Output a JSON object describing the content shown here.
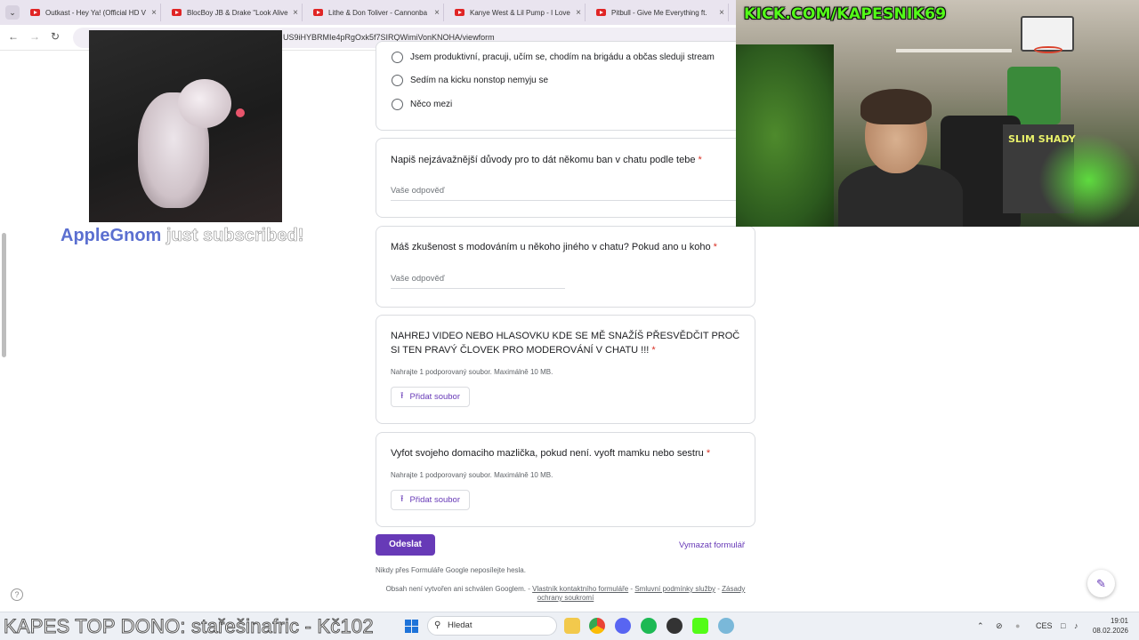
{
  "browser": {
    "tabs": [
      {
        "title": "Outkast - Hey Ya! (Official HD V"
      },
      {
        "title": "BlocBoy JB & Drake \"Look Alive"
      },
      {
        "title": "Lithe & Don Toliver - Cannonba"
      },
      {
        "title": "Kanye West & Lil Pump - I Love"
      },
      {
        "title": "Pitbull - Give Me Everything ft."
      }
    ],
    "url": "US9iHYBRMIe4pRgOxk5f7SIRQWimiVonKNOHA/viewform"
  },
  "form": {
    "radio_options": [
      "Jsem produktivní, pracuji, učím se, chodím na brigádu a občas sleduji stream",
      "Sedím na kicku nonstop nemyju se",
      "Něco mezi"
    ],
    "q_ban": {
      "text": "Napiš nejzávažnější důvody pro to dát někomu ban v chatu podle tebe",
      "required": "*",
      "placeholder": "Vaše odpověď"
    },
    "q_mod": {
      "text": "Máš zkušenost s modováním u někoho jiného v chatu? Pokud ano u koho",
      "required": "*",
      "placeholder": "Vaše odpověď"
    },
    "q_video": {
      "text": "NAHREJ VIDEO NEBO HLASOVKU KDE SE MĚ SNAŽÍŠ PŘESVĚDČIT PROČ SI TEN PRAVÝ ČLOVEK PRO MODEROVÁNÍ V CHATU !!!",
      "required": "*",
      "hint": "Nahrajte 1 podporovaný soubor. Maximálně 10 MB.",
      "button": "Přidat soubor"
    },
    "q_pet": {
      "text": "Vyfot svojeho domaciho mazlička, pokud není. vyoft mamku nebo sestru",
      "required": "*",
      "hint": "Nahrajte 1 podporovaný soubor. Maximálně 10 MB.",
      "button": "Přidat soubor"
    },
    "submit": "Odeslat",
    "clear": "Vymazat formulář",
    "never_passwords": "Nikdy přes Formuláře Google neposílejte hesla.",
    "footer_text": "Obsah není vytvořen ani schválen Googlem. -",
    "footer_links": [
      "Vlastník kontaktního formuláře",
      "Smluvní podmínky služby",
      "Zásady ochrany soukromí"
    ],
    "footer_sep": "-"
  },
  "stream": {
    "sub_name": "AppleGnom",
    "sub_rest": "just subscribed!",
    "kick_handle": "KICK.COM/KAPESNIK69",
    "poster_text": "SLIM SHADY",
    "donation": "KAPES TOP DONO: stařešinafric - Kč102"
  },
  "taskbar": {
    "search_placeholder": "Hledat",
    "lang": "CES",
    "time": "19:01",
    "date": "08.02.2026"
  },
  "colors": {
    "accent": "#673ab7",
    "required": "#d93025",
    "kick_green": "#53fc18"
  },
  "icons": [
    "search-icon",
    "upload-icon",
    "edit-icon",
    "help-icon",
    "windows-icon",
    "back-icon",
    "forward-icon",
    "reload-icon",
    "close-tab-icon"
  ]
}
